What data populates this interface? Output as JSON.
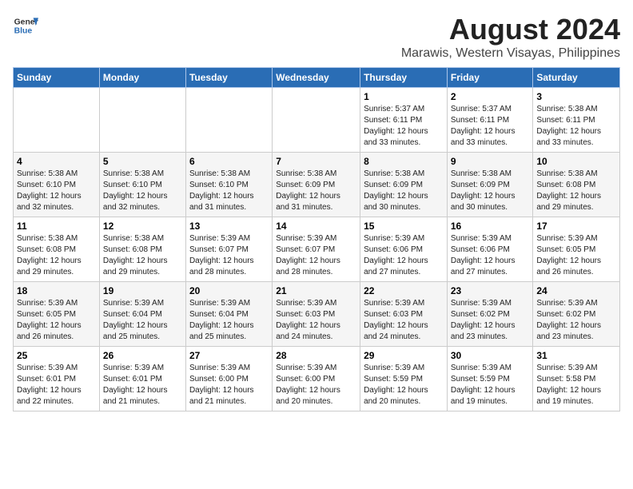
{
  "header": {
    "logo_line1": "General",
    "logo_line2": "Blue",
    "title": "August 2024",
    "subtitle": "Marawis, Western Visayas, Philippines"
  },
  "days_of_week": [
    "Sunday",
    "Monday",
    "Tuesday",
    "Wednesday",
    "Thursday",
    "Friday",
    "Saturday"
  ],
  "weeks": [
    [
      {
        "day": "",
        "info": ""
      },
      {
        "day": "",
        "info": ""
      },
      {
        "day": "",
        "info": ""
      },
      {
        "day": "",
        "info": ""
      },
      {
        "day": "1",
        "info": "Sunrise: 5:37 AM\nSunset: 6:11 PM\nDaylight: 12 hours\nand 33 minutes."
      },
      {
        "day": "2",
        "info": "Sunrise: 5:37 AM\nSunset: 6:11 PM\nDaylight: 12 hours\nand 33 minutes."
      },
      {
        "day": "3",
        "info": "Sunrise: 5:38 AM\nSunset: 6:11 PM\nDaylight: 12 hours\nand 33 minutes."
      }
    ],
    [
      {
        "day": "4",
        "info": "Sunrise: 5:38 AM\nSunset: 6:10 PM\nDaylight: 12 hours\nand 32 minutes."
      },
      {
        "day": "5",
        "info": "Sunrise: 5:38 AM\nSunset: 6:10 PM\nDaylight: 12 hours\nand 32 minutes."
      },
      {
        "day": "6",
        "info": "Sunrise: 5:38 AM\nSunset: 6:10 PM\nDaylight: 12 hours\nand 31 minutes."
      },
      {
        "day": "7",
        "info": "Sunrise: 5:38 AM\nSunset: 6:09 PM\nDaylight: 12 hours\nand 31 minutes."
      },
      {
        "day": "8",
        "info": "Sunrise: 5:38 AM\nSunset: 6:09 PM\nDaylight: 12 hours\nand 30 minutes."
      },
      {
        "day": "9",
        "info": "Sunrise: 5:38 AM\nSunset: 6:09 PM\nDaylight: 12 hours\nand 30 minutes."
      },
      {
        "day": "10",
        "info": "Sunrise: 5:38 AM\nSunset: 6:08 PM\nDaylight: 12 hours\nand 29 minutes."
      }
    ],
    [
      {
        "day": "11",
        "info": "Sunrise: 5:38 AM\nSunset: 6:08 PM\nDaylight: 12 hours\nand 29 minutes."
      },
      {
        "day": "12",
        "info": "Sunrise: 5:38 AM\nSunset: 6:08 PM\nDaylight: 12 hours\nand 29 minutes."
      },
      {
        "day": "13",
        "info": "Sunrise: 5:39 AM\nSunset: 6:07 PM\nDaylight: 12 hours\nand 28 minutes."
      },
      {
        "day": "14",
        "info": "Sunrise: 5:39 AM\nSunset: 6:07 PM\nDaylight: 12 hours\nand 28 minutes."
      },
      {
        "day": "15",
        "info": "Sunrise: 5:39 AM\nSunset: 6:06 PM\nDaylight: 12 hours\nand 27 minutes."
      },
      {
        "day": "16",
        "info": "Sunrise: 5:39 AM\nSunset: 6:06 PM\nDaylight: 12 hours\nand 27 minutes."
      },
      {
        "day": "17",
        "info": "Sunrise: 5:39 AM\nSunset: 6:05 PM\nDaylight: 12 hours\nand 26 minutes."
      }
    ],
    [
      {
        "day": "18",
        "info": "Sunrise: 5:39 AM\nSunset: 6:05 PM\nDaylight: 12 hours\nand 26 minutes."
      },
      {
        "day": "19",
        "info": "Sunrise: 5:39 AM\nSunset: 6:04 PM\nDaylight: 12 hours\nand 25 minutes."
      },
      {
        "day": "20",
        "info": "Sunrise: 5:39 AM\nSunset: 6:04 PM\nDaylight: 12 hours\nand 25 minutes."
      },
      {
        "day": "21",
        "info": "Sunrise: 5:39 AM\nSunset: 6:03 PM\nDaylight: 12 hours\nand 24 minutes."
      },
      {
        "day": "22",
        "info": "Sunrise: 5:39 AM\nSunset: 6:03 PM\nDaylight: 12 hours\nand 24 minutes."
      },
      {
        "day": "23",
        "info": "Sunrise: 5:39 AM\nSunset: 6:02 PM\nDaylight: 12 hours\nand 23 minutes."
      },
      {
        "day": "24",
        "info": "Sunrise: 5:39 AM\nSunset: 6:02 PM\nDaylight: 12 hours\nand 23 minutes."
      }
    ],
    [
      {
        "day": "25",
        "info": "Sunrise: 5:39 AM\nSunset: 6:01 PM\nDaylight: 12 hours\nand 22 minutes."
      },
      {
        "day": "26",
        "info": "Sunrise: 5:39 AM\nSunset: 6:01 PM\nDaylight: 12 hours\nand 21 minutes."
      },
      {
        "day": "27",
        "info": "Sunrise: 5:39 AM\nSunset: 6:00 PM\nDaylight: 12 hours\nand 21 minutes."
      },
      {
        "day": "28",
        "info": "Sunrise: 5:39 AM\nSunset: 6:00 PM\nDaylight: 12 hours\nand 20 minutes."
      },
      {
        "day": "29",
        "info": "Sunrise: 5:39 AM\nSunset: 5:59 PM\nDaylight: 12 hours\nand 20 minutes."
      },
      {
        "day": "30",
        "info": "Sunrise: 5:39 AM\nSunset: 5:59 PM\nDaylight: 12 hours\nand 19 minutes."
      },
      {
        "day": "31",
        "info": "Sunrise: 5:39 AM\nSunset: 5:58 PM\nDaylight: 12 hours\nand 19 minutes."
      }
    ]
  ]
}
